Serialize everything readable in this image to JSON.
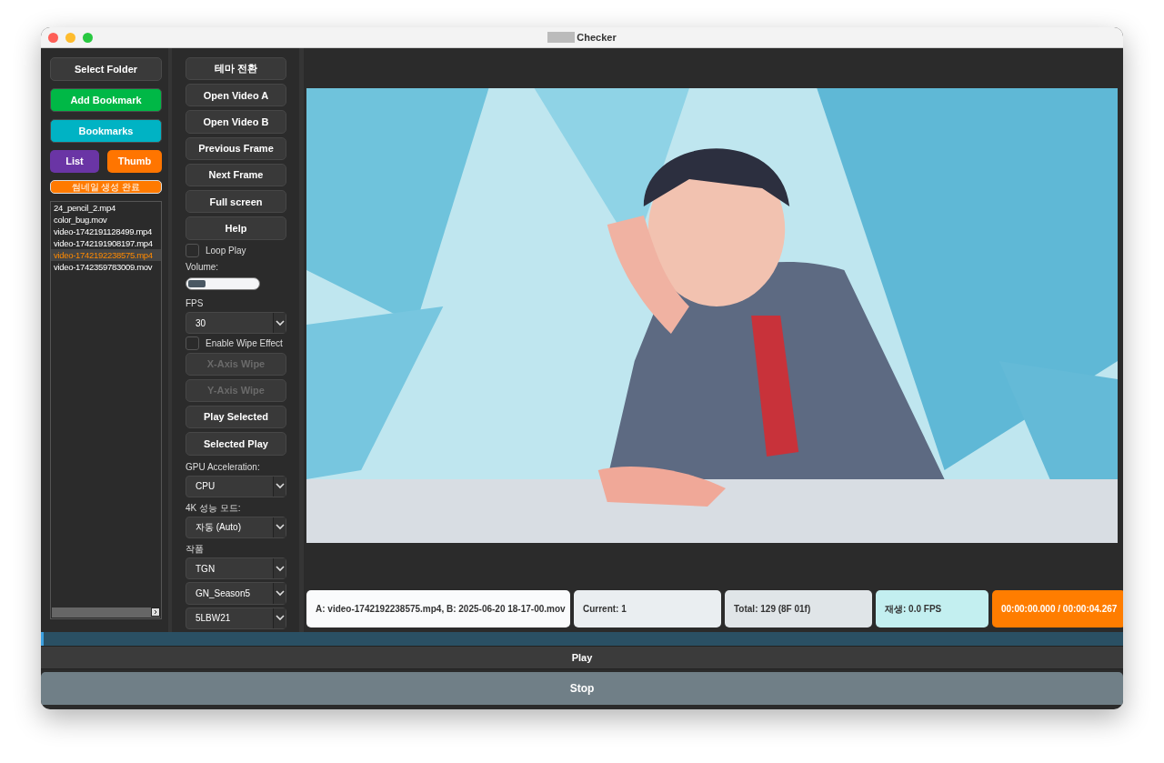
{
  "window": {
    "title": "Checker"
  },
  "left_panel": {
    "buttons": [
      {
        "label": "Select Folder",
        "color": "#3a3a3a"
      },
      {
        "label": "Add Bookmark",
        "color": "#00b846"
      },
      {
        "label": "Bookmarks",
        "color": "#00b3c4"
      }
    ],
    "view_toggle": [
      {
        "label": "List",
        "color": "#6a35a5"
      },
      {
        "label": "Thumb",
        "color": "#ff7500"
      }
    ],
    "status": "썸네일 생성 완료",
    "files": [
      {
        "name": "24_pencil_2.mp4",
        "selected": false
      },
      {
        "name": "color_bug.mov",
        "selected": false
      },
      {
        "name": "video-1742191128499.mp4",
        "selected": false
      },
      {
        "name": "video-1742191908197.mp4",
        "selected": false
      },
      {
        "name": "video-1742192238575.mp4",
        "selected": true
      },
      {
        "name": "video-1742359783009.mov",
        "selected": false
      }
    ]
  },
  "controls": [
    {
      "kind": "button",
      "label": "테마 전환",
      "disabled": false
    },
    {
      "kind": "button",
      "label": "Open Video A",
      "disabled": false
    },
    {
      "kind": "button",
      "label": "Open Video B",
      "disabled": false
    },
    {
      "kind": "button",
      "label": "Previous Frame",
      "disabled": false
    },
    {
      "kind": "button",
      "label": "Next Frame",
      "disabled": false
    },
    {
      "kind": "button",
      "label": "Full screen",
      "disabled": false
    },
    {
      "kind": "button",
      "label": "Help",
      "disabled": false
    },
    {
      "kind": "checkbox",
      "label": "Loop Play",
      "checked": false
    },
    {
      "kind": "label",
      "label": "Volume:"
    },
    {
      "kind": "slider",
      "level": 0.25
    },
    {
      "kind": "label",
      "label": "FPS"
    },
    {
      "kind": "select",
      "value": "30"
    },
    {
      "kind": "checkbox",
      "label": "Enable Wipe Effect",
      "checked": false
    },
    {
      "kind": "button",
      "label": "X-Axis Wipe",
      "disabled": true
    },
    {
      "kind": "button",
      "label": "Y-Axis Wipe",
      "disabled": true
    },
    {
      "kind": "button",
      "label": "Play Selected",
      "disabled": false
    },
    {
      "kind": "button",
      "label": "Selected Play",
      "disabled": false
    },
    {
      "kind": "label",
      "label": "GPU Acceleration:"
    },
    {
      "kind": "select",
      "value": "CPU"
    },
    {
      "kind": "label",
      "label": "4K 성능 모드:"
    },
    {
      "kind": "select",
      "value": "자동 (Auto)"
    },
    {
      "kind": "label",
      "label": "작품"
    },
    {
      "kind": "select",
      "value": "TGN"
    },
    {
      "kind": "select",
      "value": "GN_Season5"
    },
    {
      "kind": "select",
      "value": "5LBW21"
    }
  ],
  "status_cards": [
    {
      "text": "A: video-1742192238575.mp4, B: 2025-06-20 18-17-00.mov",
      "color": "#fafbfc"
    },
    {
      "text": "Current: 1",
      "color": "#eaeef1"
    },
    {
      "text": "Total: 129 (8F 01f)",
      "color": "#e0e5e8"
    },
    {
      "text": "재생: 0.0 FPS",
      "color": "#c3eff0"
    },
    {
      "text": "00:00:00.000 / 00:00:04.267",
      "color": "#ff7d00"
    }
  ],
  "play_button": "Play",
  "stop_button": "Stop"
}
